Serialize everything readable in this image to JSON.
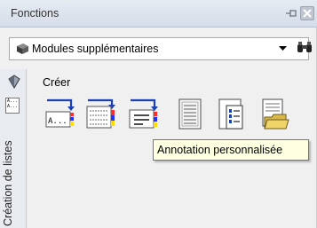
{
  "panel": {
    "title": "Fonctions"
  },
  "combo": {
    "selected": "Modules supplémentaires"
  },
  "section": {
    "label": "Créer"
  },
  "sidebar": {
    "vertical_label": "Création de listes",
    "lists_icon_text": "A...\nA..."
  },
  "tools": [
    {
      "name": "tool-annotation-text",
      "glyph": "A..."
    },
    {
      "name": "tool-annotation-table"
    },
    {
      "name": "tool-annotation-custom"
    },
    {
      "name": "tool-list-report"
    },
    {
      "name": "tool-list-detail"
    },
    {
      "name": "tool-list-folder"
    }
  ],
  "tooltip": {
    "text": "Annotation personnalisée"
  },
  "icons": [
    "pin-icon",
    "close-icon",
    "cube-icon",
    "dropdown-arrow-icon",
    "binoculars-icon",
    "create-icon",
    "lists-icon"
  ]
}
